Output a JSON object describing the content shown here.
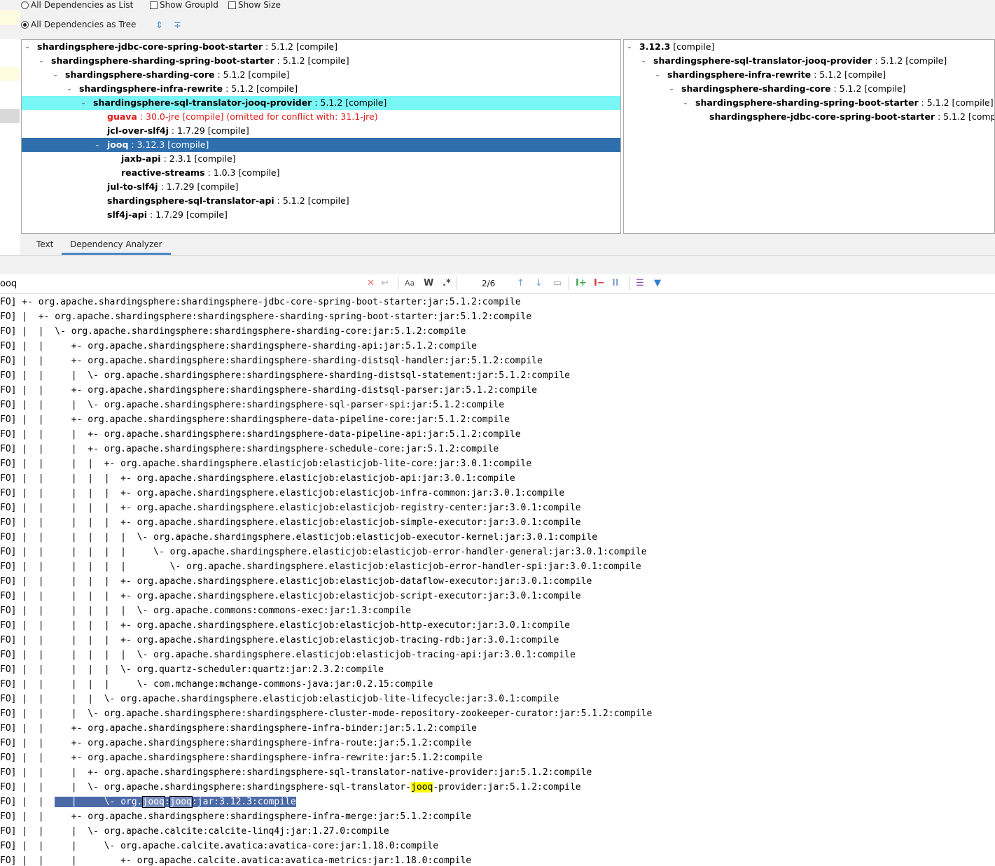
{
  "options": {
    "list_label": "All Dependencies as List",
    "tree_label": "All Dependencies as Tree",
    "show_groupid": "Show GroupId",
    "show_size": "Show Size",
    "selected": "tree"
  },
  "left_tree": [
    {
      "name": "shardingsphere-jdbc-core-spring-boot-starter",
      "meta": " : 5.1.2 [compile]",
      "expanded": true
    },
    {
      "name": "shardingsphere-sharding-spring-boot-starter",
      "meta": " : 5.1.2 [compile]",
      "expanded": true
    },
    {
      "name": "shardingsphere-sharding-core",
      "meta": " : 5.1.2 [compile]",
      "expanded": true
    },
    {
      "name": "shardingsphere-infra-rewrite",
      "meta": " : 5.1.2 [compile]",
      "expanded": true
    },
    {
      "name": "shardingsphere-sql-translator-jooq-provider",
      "meta": " : 5.1.2 [compile]",
      "expanded": true
    },
    {
      "name": "guava",
      "meta": " : 30.0-jre [compile] (omitted for conflict with: 31.1-jre)"
    },
    {
      "name": "jcl-over-slf4j",
      "meta": " : 1.7.29 [compile]"
    },
    {
      "name": "jooq",
      "meta": " : 3.12.3 [compile]",
      "expanded": true
    },
    {
      "name": "jaxb-api",
      "meta": " : 2.3.1 [compile]"
    },
    {
      "name": "reactive-streams",
      "meta": " : 1.0.3 [compile]"
    },
    {
      "name": "jul-to-slf4j",
      "meta": " : 1.7.29 [compile]"
    },
    {
      "name": "shardingsphere-sql-translator-api",
      "meta": " : 5.1.2 [compile]"
    },
    {
      "name": "slf4j-api",
      "meta": " : 1.7.29 [compile]"
    }
  ],
  "right_tree": [
    {
      "name": "3.12.3",
      "meta": " [compile]"
    },
    {
      "name": "shardingsphere-sql-translator-jooq-provider",
      "meta": " : 5.1.2 [compile]"
    },
    {
      "name": "shardingsphere-infra-rewrite",
      "meta": " : 5.1.2 [compile]"
    },
    {
      "name": "shardingsphere-sharding-core",
      "meta": " : 5.1.2 [compile]"
    },
    {
      "name": "shardingsphere-sharding-spring-boot-starter",
      "meta": " : 5.1.2 [compile]"
    },
    {
      "name": "shardingsphere-jdbc-core-spring-boot-starter",
      "meta": " : 5.1.2 [compile]"
    }
  ],
  "tabs": {
    "text": "Text",
    "analyzer": "Dependency Analyzer",
    "active": "analyzer"
  },
  "search": {
    "query": "ooq",
    "match_count": "2/6",
    "case_label": "Aa",
    "word_label": "W",
    "regex_label": ".*"
  },
  "console_lines": [
    "FO] +- org.apache.shardingsphere:shardingsphere-jdbc-core-spring-boot-starter:jar:5.1.2:compile",
    "FO] |  +- org.apache.shardingsphere:shardingsphere-sharding-spring-boot-starter:jar:5.1.2:compile",
    "FO] |  |  \\- org.apache.shardingsphere:shardingsphere-sharding-core:jar:5.1.2:compile",
    "FO] |  |     +- org.apache.shardingsphere:shardingsphere-sharding-api:jar:5.1.2:compile",
    "FO] |  |     +- org.apache.shardingsphere:shardingsphere-sharding-distsql-handler:jar:5.1.2:compile",
    "FO] |  |     |  \\- org.apache.shardingsphere:shardingsphere-sharding-distsql-statement:jar:5.1.2:compile",
    "FO] |  |     +- org.apache.shardingsphere:shardingsphere-sharding-distsql-parser:jar:5.1.2:compile",
    "FO] |  |     |  \\- org.apache.shardingsphere:shardingsphere-sql-parser-spi:jar:5.1.2:compile",
    "FO] |  |     +- org.apache.shardingsphere:shardingsphere-data-pipeline-core:jar:5.1.2:compile",
    "FO] |  |     |  +- org.apache.shardingsphere:shardingsphere-data-pipeline-api:jar:5.1.2:compile",
    "FO] |  |     |  +- org.apache.shardingsphere:shardingsphere-schedule-core:jar:5.1.2:compile",
    "FO] |  |     |  |  +- org.apache.shardingsphere.elasticjob:elasticjob-lite-core:jar:3.0.1:compile",
    "FO] |  |     |  |  |  +- org.apache.shardingsphere.elasticjob:elasticjob-api:jar:3.0.1:compile",
    "FO] |  |     |  |  |  +- org.apache.shardingsphere.elasticjob:elasticjob-infra-common:jar:3.0.1:compile",
    "FO] |  |     |  |  |  +- org.apache.shardingsphere.elasticjob:elasticjob-registry-center:jar:3.0.1:compile",
    "FO] |  |     |  |  |  +- org.apache.shardingsphere.elasticjob:elasticjob-simple-executor:jar:3.0.1:compile",
    "FO] |  |     |  |  |  |  \\- org.apache.shardingsphere.elasticjob:elasticjob-executor-kernel:jar:3.0.1:compile",
    "FO] |  |     |  |  |  |     \\- org.apache.shardingsphere.elasticjob:elasticjob-error-handler-general:jar:3.0.1:compile",
    "FO] |  |     |  |  |  |        \\- org.apache.shardingsphere.elasticjob:elasticjob-error-handler-spi:jar:3.0.1:compile",
    "FO] |  |     |  |  |  +- org.apache.shardingsphere.elasticjob:elasticjob-dataflow-executor:jar:3.0.1:compile",
    "FO] |  |     |  |  |  +- org.apache.shardingsphere.elasticjob:elasticjob-script-executor:jar:3.0.1:compile",
    "FO] |  |     |  |  |  |  \\- org.apache.commons:commons-exec:jar:1.3:compile",
    "FO] |  |     |  |  |  +- org.apache.shardingsphere.elasticjob:elasticjob-http-executor:jar:3.0.1:compile",
    "FO] |  |     |  |  |  +- org.apache.shardingsphere.elasticjob:elasticjob-tracing-rdb:jar:3.0.1:compile",
    "FO] |  |     |  |  |  |  \\- org.apache.shardingsphere.elasticjob:elasticjob-tracing-api:jar:3.0.1:compile",
    "FO] |  |     |  |  |  \\- org.quartz-scheduler:quartz:jar:2.3.2:compile",
    "FO] |  |     |  |  |     \\- com.mchange:mchange-commons-java:jar:0.2.15:compile",
    "FO] |  |     |  |  \\- org.apache.shardingsphere.elasticjob:elasticjob-lite-lifecycle:jar:3.0.1:compile",
    "FO] |  |     |  \\- org.apache.shardingsphere:shardingsphere-cluster-mode-repository-zookeeper-curator:jar:5.1.2:compile",
    "FO] |  |     +- org.apache.shardingsphere:shardingsphere-infra-binder:jar:5.1.2:compile",
    "FO] |  |     +- org.apache.shardingsphere:shardingsphere-infra-route:jar:5.1.2:compile",
    "FO] |  |     +- org.apache.shardingsphere:shardingsphere-infra-rewrite:jar:5.1.2:compile",
    "FO] |  |     |  +- org.apache.shardingsphere:shardingsphere-sql-translator-native-provider:jar:5.1.2:compile",
    "FO] |  |     |  \\- org.apache.shardingsphere:shardingsphere-sql-translator-jooq-provider:jar:5.1.2:compile",
    "FO] |  |     |     \\- org.jooq:jooq:jar:3.12.3:compile",
    "FO] |  |     +- org.apache.shardingsphere:shardingsphere-infra-merge:jar:5.1.2:compile",
    "FO] |  |     |  \\- org.apache.calcite:calcite-linq4j:jar:1.27.0:compile",
    "FO] |  |     |     \\- org.apache.calcite.avatica:avatica-core:jar:1.18.0:compile",
    "FO] |  |     |        +- org.apache.calcite.avatica:avatica-metrics:jar:1.18.0:compile"
  ]
}
